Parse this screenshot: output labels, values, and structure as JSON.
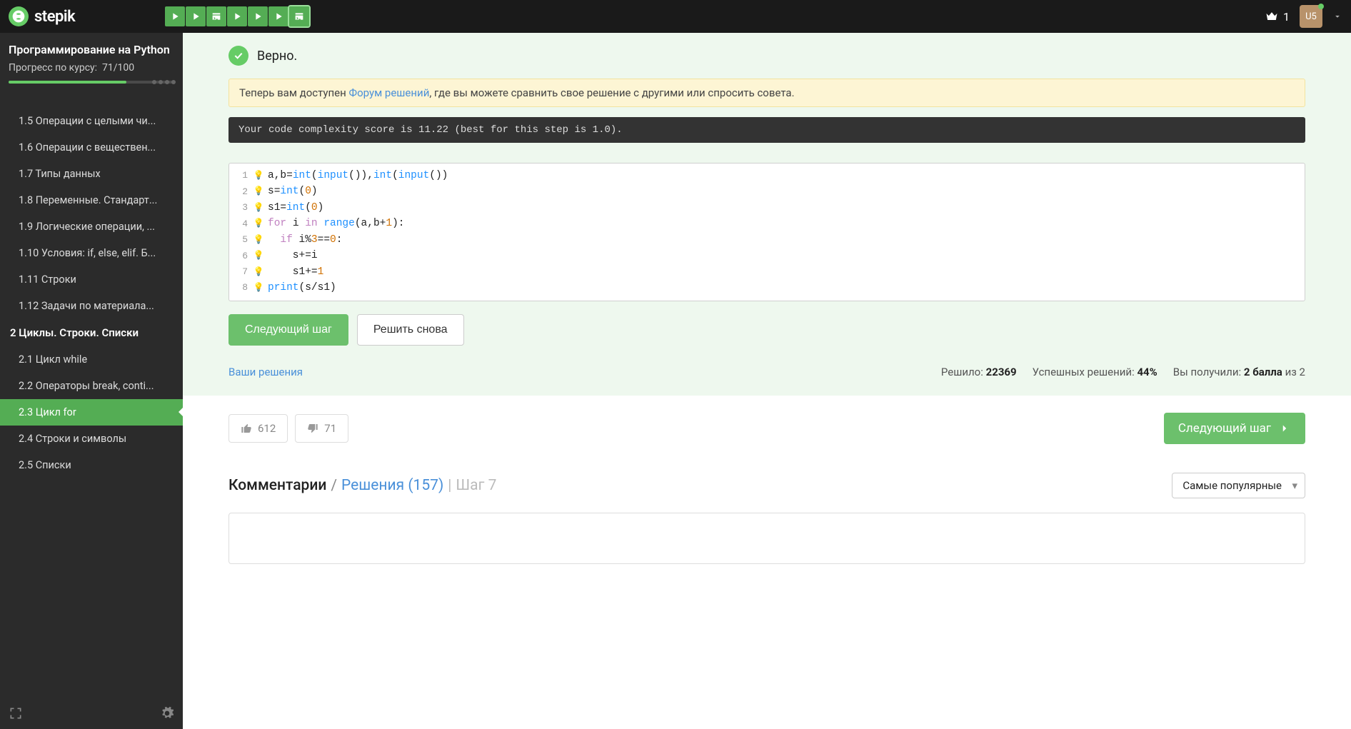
{
  "brand": "stepik",
  "topbar": {
    "crown_count": "1",
    "avatar": "U5",
    "steps": [
      {
        "type": "play"
      },
      {
        "type": "play"
      },
      {
        "type": "code"
      },
      {
        "type": "play"
      },
      {
        "type": "play"
      },
      {
        "type": "play"
      },
      {
        "type": "code",
        "active": true
      }
    ]
  },
  "sidebar": {
    "course_title": "Программирование на Python",
    "progress_label": "Прогресс по курсу:",
    "progress_value": "71/100",
    "items": [
      {
        "num": "1.5",
        "label": "Операции с целыми чи..."
      },
      {
        "num": "1.6",
        "label": "Операции с веществен..."
      },
      {
        "num": "1.7",
        "label": "Типы данных"
      },
      {
        "num": "1.8",
        "label": "Переменные. Стандарт..."
      },
      {
        "num": "1.9",
        "label": "Логические операции, ..."
      },
      {
        "num": "1.10",
        "label": "Условия: if, else, elif. Б..."
      },
      {
        "num": "1.11",
        "label": "Строки"
      },
      {
        "num": "1.12",
        "label": "Задачи по материала..."
      }
    ],
    "section2": "2  Циклы. Строки. Списки",
    "items2": [
      {
        "num": "2.1",
        "label": "Цикл while"
      },
      {
        "num": "2.2",
        "label": "Операторы break, conti..."
      },
      {
        "num": "2.3",
        "label": "Цикл for",
        "active": true
      },
      {
        "num": "2.4",
        "label": "Строки и символы"
      },
      {
        "num": "2.5",
        "label": "Списки"
      }
    ]
  },
  "main": {
    "verdict": "Верно.",
    "info_prefix": "Теперь вам доступен ",
    "info_link": "Форум решений",
    "info_suffix": ", где вы можете сравнить свое решение с другими или спросить совета.",
    "code_hint": "Your code complexity score is 11.22 (best for this step is 1.0).",
    "next_btn": "Следующий шаг",
    "retry_btn": "Решить снова",
    "your_solutions": "Ваши решения",
    "solved_label": "Решило:",
    "solved_value": "22369",
    "success_label": "Успешных решений:",
    "success_value": "44%",
    "points_label": "Вы получили:",
    "points_value": "2 балла",
    "points_suffix": "из 2",
    "likes": "612",
    "dislikes": "71",
    "next_big": "Следующий шаг",
    "comments_tab": "Комментарии",
    "solutions_tab": "Решения (157)",
    "step_label": "Шаг 7",
    "sort_label": "Самые популярные"
  },
  "code": [
    {
      "n": 1,
      "tokens": [
        {
          "t": "a,b="
        },
        {
          "t": "int",
          "c": "fn"
        },
        {
          "t": "("
        },
        {
          "t": "input",
          "c": "fn"
        },
        {
          "t": "()),"
        },
        {
          "t": "int",
          "c": "fn"
        },
        {
          "t": "("
        },
        {
          "t": "input",
          "c": "fn"
        },
        {
          "t": "())"
        }
      ]
    },
    {
      "n": 2,
      "tokens": [
        {
          "t": "s="
        },
        {
          "t": "int",
          "c": "fn"
        },
        {
          "t": "("
        },
        {
          "t": "0",
          "c": "num"
        },
        {
          "t": ")"
        }
      ]
    },
    {
      "n": 3,
      "tokens": [
        {
          "t": "s1="
        },
        {
          "t": "int",
          "c": "fn"
        },
        {
          "t": "("
        },
        {
          "t": "0",
          "c": "num"
        },
        {
          "t": ")"
        }
      ]
    },
    {
      "n": 4,
      "tokens": [
        {
          "t": "for ",
          "c": "kw"
        },
        {
          "t": "i "
        },
        {
          "t": "in ",
          "c": "kw"
        },
        {
          "t": "range",
          "c": "fn"
        },
        {
          "t": "(a,b+"
        },
        {
          "t": "1",
          "c": "num"
        },
        {
          "t": "):"
        }
      ]
    },
    {
      "n": 5,
      "tokens": [
        {
          "t": "  "
        },
        {
          "t": "if ",
          "c": "kw"
        },
        {
          "t": "i%"
        },
        {
          "t": "3",
          "c": "num"
        },
        {
          "t": "=="
        },
        {
          "t": "0",
          "c": "num"
        },
        {
          "t": ":"
        }
      ]
    },
    {
      "n": 6,
      "tokens": [
        {
          "t": "    s+=i"
        }
      ]
    },
    {
      "n": 7,
      "tokens": [
        {
          "t": "    s1+="
        },
        {
          "t": "1",
          "c": "num"
        }
      ]
    },
    {
      "n": 8,
      "tokens": [
        {
          "t": "print",
          "c": "fn"
        },
        {
          "t": "(s/s1)"
        }
      ]
    }
  ]
}
